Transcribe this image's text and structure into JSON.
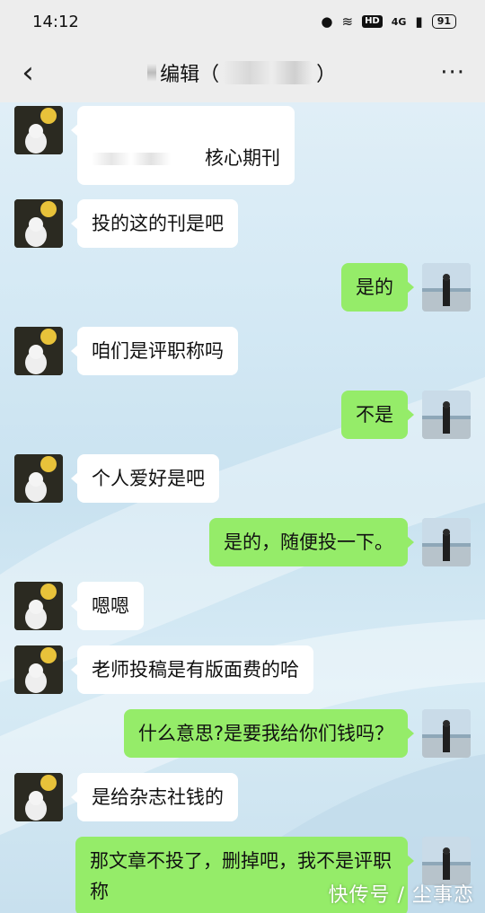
{
  "status_bar": {
    "time": "14:12",
    "network": "4G",
    "hd": "HD",
    "battery": "91"
  },
  "header": {
    "title": "编辑（",
    "title_end": "）",
    "back_icon": "chevron-left-icon",
    "more_icon": "more-icon",
    "more": "···"
  },
  "messages": [
    {
      "from": "other",
      "text": "核心期刊"
    },
    {
      "from": "other",
      "text": "投的这的刊是吧"
    },
    {
      "from": "me",
      "text": "是的"
    },
    {
      "from": "other",
      "text": "咱们是评职称吗"
    },
    {
      "from": "me",
      "text": "不是"
    },
    {
      "from": "other",
      "text": "个人爱好是吧"
    },
    {
      "from": "me",
      "text": "是的，随便投一下。"
    },
    {
      "from": "other",
      "text": "嗯嗯"
    },
    {
      "from": "other",
      "text": "老师投稿是有版面费的哈"
    },
    {
      "from": "me",
      "text": "什么意思?是要我给你们钱吗？"
    },
    {
      "from": "other",
      "text": "是给杂志社钱的"
    },
    {
      "from": "me",
      "text": "那文章不投了，删掉吧，我不是评职称"
    }
  ],
  "watermark": "快传号 / 尘事恋",
  "colors": {
    "out_bubble": "#95ec69",
    "in_bubble": "#ffffff",
    "bar": "#ededed"
  }
}
